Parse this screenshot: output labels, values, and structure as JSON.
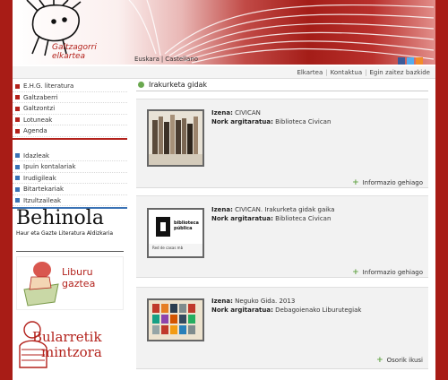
{
  "header": {
    "logo_line1": "Galtzagorri",
    "logo_line2": "elkartea",
    "languages": [
      "Euskara",
      "Castellano"
    ]
  },
  "topnav": {
    "links": [
      "Elkartea",
      "Kontaktua",
      "Egin zaitez bazkide"
    ]
  },
  "sidebar": {
    "menu1": [
      "E.H.G. literatura",
      "Galtzaberri",
      "Galtzontzi",
      "Lotuneak",
      "Agenda"
    ],
    "menu2": [
      "Idazleak",
      "Ipuin kontalariak",
      "Irudigileak",
      "Bitartekariak",
      "Itzultzaileak"
    ],
    "promos": {
      "behinola_title": "Behinola",
      "behinola_sub": "Haur eta Gazte Literatura Aldizkaria",
      "liburu_line1": "Liburu",
      "liburu_line2": "gaztea",
      "bular_line1": "Bularretik",
      "bular_line2": "mintzora"
    }
  },
  "main": {
    "title": "Irakurketa gidak",
    "cards": [
      {
        "name_label": "Izena:",
        "name": "CIVICAN",
        "publisher_label": "Nork argitaratua:",
        "publisher": "Biblioteca Civican",
        "more": "Informazio gehiago"
      },
      {
        "name_label": "Izena:",
        "name": "CIVICAN. Irakurketa gidak gaika",
        "publisher_label": "Nork argitaratua:",
        "publisher": "Biblioteca Civican",
        "more": "Informazio gehiago",
        "thumb_text": "biblioteca pública",
        "thumb_sub": "Red de casas mb"
      },
      {
        "name_label": "Izena:",
        "name": "Neguko Gida. 2013",
        "publisher_label": "Nork argitaratua:",
        "publisher": "Debagoienako Liburutegiak",
        "more": "Osorik ikusi"
      }
    ]
  },
  "colors": {
    "brand_red": "#b3221c",
    "accent_blue": "#3b73b5",
    "accent_green": "#6aa84f"
  }
}
